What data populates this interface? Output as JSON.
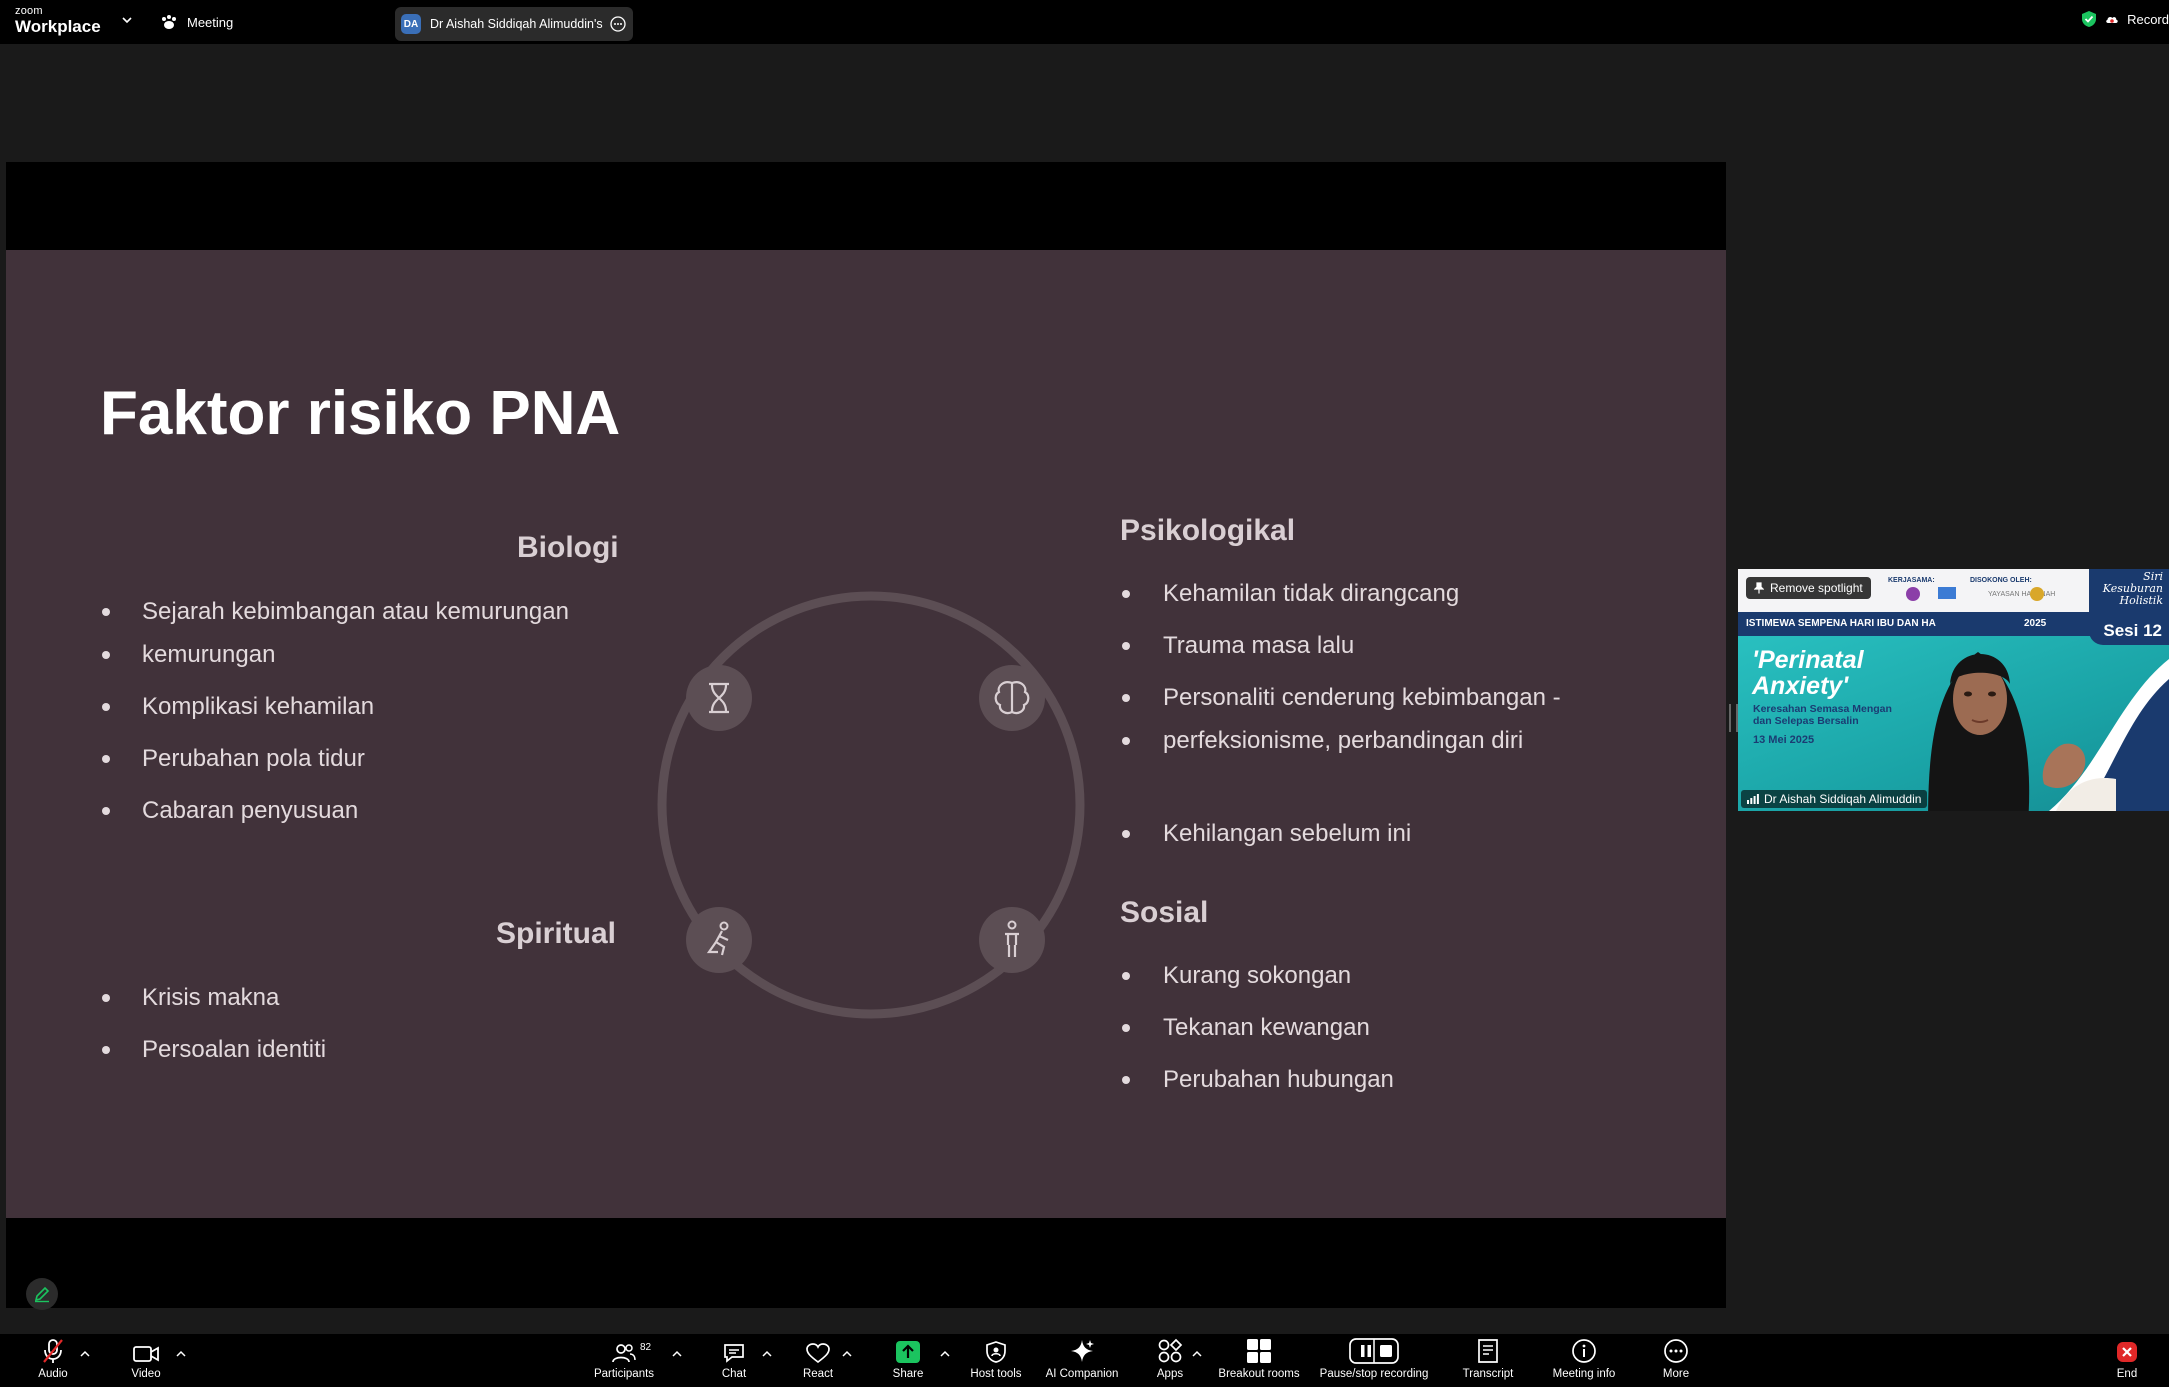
{
  "app": {
    "brand_small": "zoom",
    "brand_name": "Workplace"
  },
  "topbar": {
    "meeting_label": "Meeting",
    "share_tab": {
      "initials": "DA",
      "name": "Dr Aishah Siddiqah Alimuddin's s"
    },
    "record_label": "Record"
  },
  "slide": {
    "title": "Faktor risiko PNA",
    "sections": {
      "biologi": {
        "heading": "Biologi",
        "items": [
          "Sejarah kebimbangan atau kemurungan",
          "kemurungan",
          "Komplikasi kehamilan",
          "Perubahan pola tidur",
          "Cabaran penyusuan"
        ]
      },
      "spiritual": {
        "heading": "Spiritual",
        "items": [
          "Krisis makna",
          "Persoalan identiti"
        ]
      },
      "psikologikal": {
        "heading": "Psikologikal",
        "items": [
          "Kehamilan tidak dirangcang",
          "Trauma masa lalu",
          "Personaliti cenderung kebimbangan -",
          "perfeksionisme, perbandingan diri",
          "Kehilangan sebelum ini"
        ]
      },
      "sosial": {
        "heading": "Sosial",
        "items": [
          "Kurang sokongan",
          "Tekanan kewangan",
          "Perubahan hubungan"
        ]
      }
    },
    "cycle_icons": [
      "dna-icon",
      "brain-icon",
      "kneeling-person-icon",
      "standing-person-icon"
    ]
  },
  "video": {
    "spotlight_label": "Remove spotlight",
    "participant_name": "Dr Aishah Siddiqah Alimuddin",
    "banner": {
      "top_left": "KERJASAMA:",
      "top_mid": "DISOKONG OLEH:",
      "org": "YAYASAN HASANAH",
      "strip": "ISTIMEWA SEMPENA HARI IBU DAN HA",
      "strip_year": "2025",
      "title_line1": "'Perinatal",
      "title_line2": "Anxiety'",
      "sub_line1": "Keresahan Semasa Mengan",
      "sub_line2": "dan Selepas Bersalin",
      "date": "13 Mei 2025",
      "series_line1": "Siri",
      "series_line2": "Kesuburan",
      "series_line3": "Holistik",
      "series_number": "Sesi 12"
    }
  },
  "toolbar": {
    "audio": "Audio",
    "video": "Video",
    "participants": "Participants",
    "participants_count": "82",
    "chat": "Chat",
    "react": "React",
    "share": "Share",
    "host_tools": "Host tools",
    "ai_companion": "AI Companion",
    "apps": "Apps",
    "breakout_rooms": "Breakout rooms",
    "pause_recording": "Pause/stop recording",
    "transcript": "Transcript",
    "meeting_info": "Meeting info",
    "more": "More",
    "end": "End"
  },
  "colors": {
    "slide_bg": "#41323a",
    "share_green": "#1bc45f",
    "end_red": "#e02828",
    "banner_navy": "#1a3a6e",
    "banner_teal": "#1fa8aa"
  }
}
